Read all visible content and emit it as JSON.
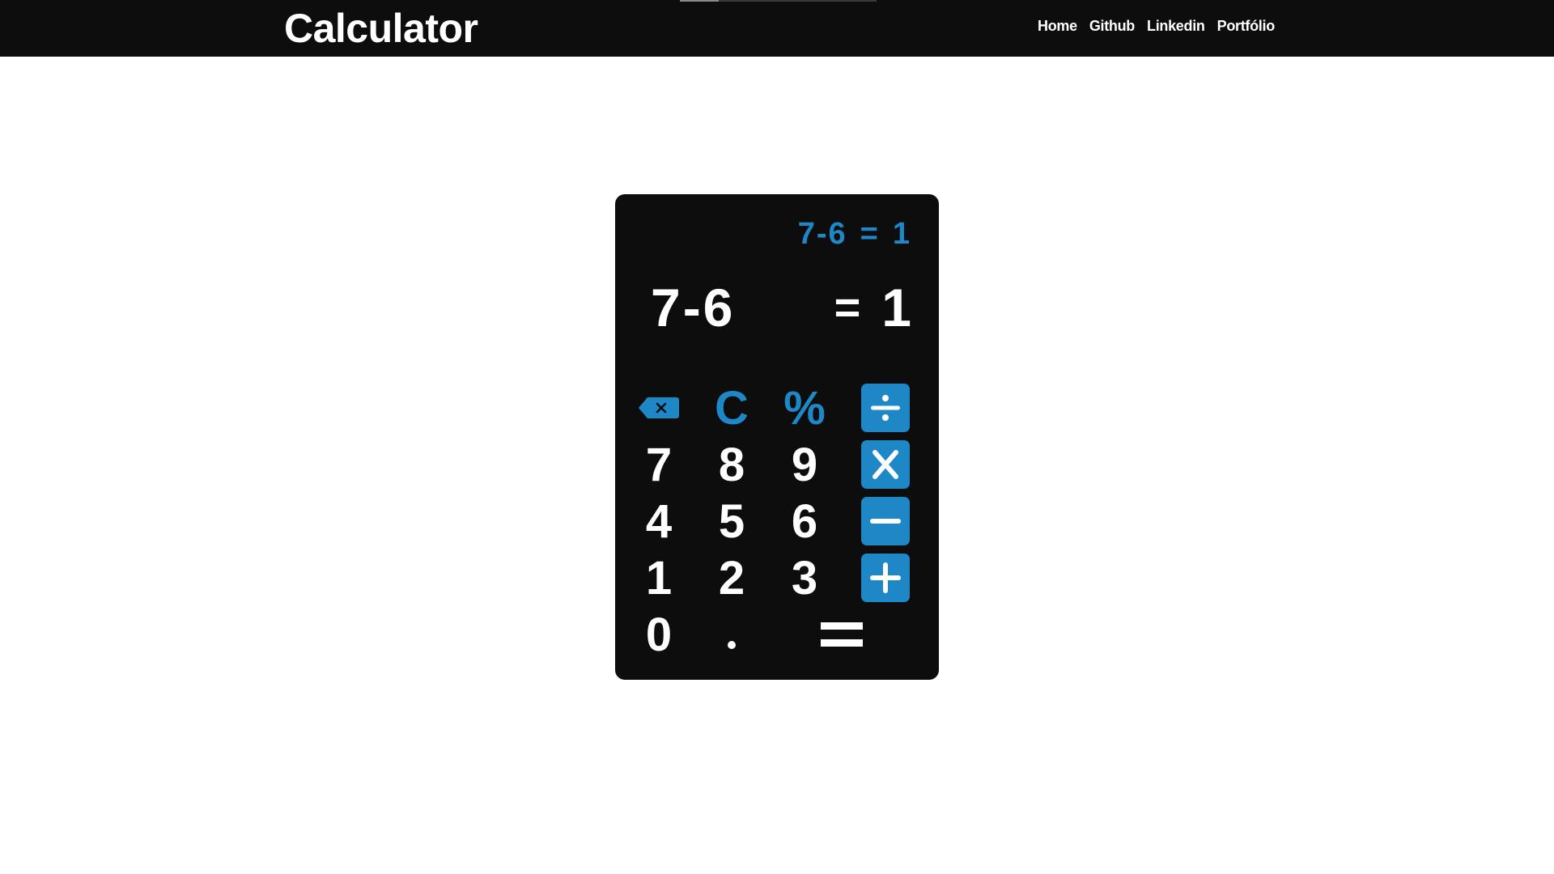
{
  "header": {
    "title": "Calculator",
    "nav": [
      "Home",
      "Github",
      "Linkedin",
      "Portfólio"
    ]
  },
  "calculator": {
    "history": {
      "expression": "7-6",
      "equals": "=",
      "result": "1"
    },
    "display": {
      "expression": "7-6",
      "equals": "=",
      "result": "1"
    },
    "keys": {
      "backspace": "backspace-icon",
      "clear": "C",
      "percent": "%",
      "divide": "divide-icon",
      "seven": "7",
      "eight": "8",
      "nine": "9",
      "multiply": "multiply-icon",
      "four": "4",
      "five": "5",
      "six": "6",
      "subtract": "minus-icon",
      "one": "1",
      "two": "2",
      "three": "3",
      "add": "plus-icon",
      "zero": "0",
      "dot": ".",
      "equals": "equals-icon"
    }
  },
  "colors": {
    "header_bg": "#0d0d0d",
    "calculator_bg": "#0d0d0d",
    "accent": "#1e88c7",
    "key_text": "#ffffff",
    "page_bg": "#ffffff"
  }
}
